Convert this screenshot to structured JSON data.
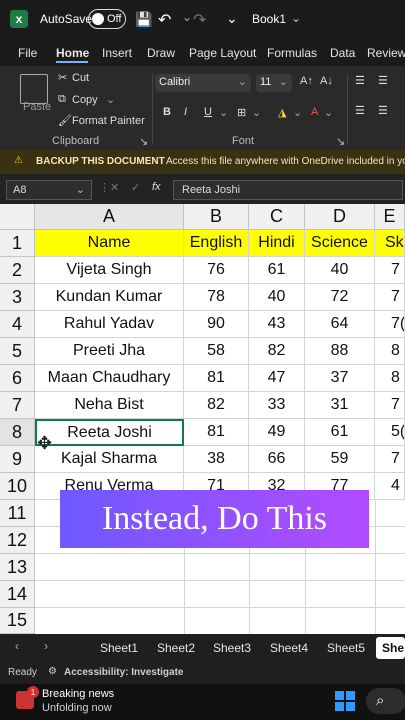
{
  "app": {
    "autosave_label": "AutoSave",
    "autosave_state": "Off",
    "file_name": "Book1"
  },
  "tabs": [
    "File",
    "Home",
    "Insert",
    "Draw",
    "Page Layout",
    "Formulas",
    "Data",
    "Review"
  ],
  "ribbon": {
    "clipboard": {
      "paste": "Paste",
      "cut": "Cut",
      "copy": "Copy",
      "format_painter": "Format Painter",
      "group_label": "Clipboard"
    },
    "font": {
      "name": "Calibri",
      "size": "11",
      "group_label": "Font"
    }
  },
  "notice": {
    "title": "BACKUP THIS DOCUMENT",
    "text": "Access this file anywhere with OneDrive included in yo"
  },
  "formula_bar": {
    "name_box": "A8",
    "fx": "fx",
    "value": "Reeta Joshi"
  },
  "grid": {
    "columns": [
      "A",
      "B",
      "C",
      "D",
      "E"
    ],
    "headers": [
      "Name",
      "English",
      "Hindi",
      "Science",
      "Sk"
    ],
    "rows": [
      [
        "Vijeta Singh",
        "76",
        "61",
        "40",
        "7"
      ],
      [
        "Kundan Kumar",
        "78",
        "40",
        "72",
        "7"
      ],
      [
        "Rahul Yadav",
        "90",
        "43",
        "64",
        "7("
      ],
      [
        "Preeti Jha",
        "58",
        "82",
        "88",
        "8"
      ],
      [
        "Maan Chaudhary",
        "81",
        "47",
        "37",
        "8"
      ],
      [
        "Neha Bist",
        "82",
        "33",
        "31",
        "7"
      ],
      [
        "Reeta Joshi",
        "81",
        "49",
        "61",
        "5("
      ],
      [
        "Kajal Sharma",
        "38",
        "66",
        "59",
        "7"
      ],
      [
        "Renu Verma",
        "71",
        "32",
        "77",
        "4"
      ]
    ],
    "row_numbers": [
      "1",
      "2",
      "3",
      "4",
      "5",
      "6",
      "7",
      "8",
      "9",
      "10",
      "11",
      "12",
      "13",
      "14",
      "15"
    ]
  },
  "overlay_text": "Instead, Do This",
  "sheet_tabs": [
    "Sheet1",
    "Sheet2",
    "Sheet3",
    "Sheet4",
    "Sheet5",
    "She"
  ],
  "status": {
    "ready": "Ready",
    "accessibility": "Accessibility: Investigate"
  },
  "taskbar": {
    "news_title": "Breaking news",
    "news_sub": "Unfolding now",
    "badge": "1"
  }
}
